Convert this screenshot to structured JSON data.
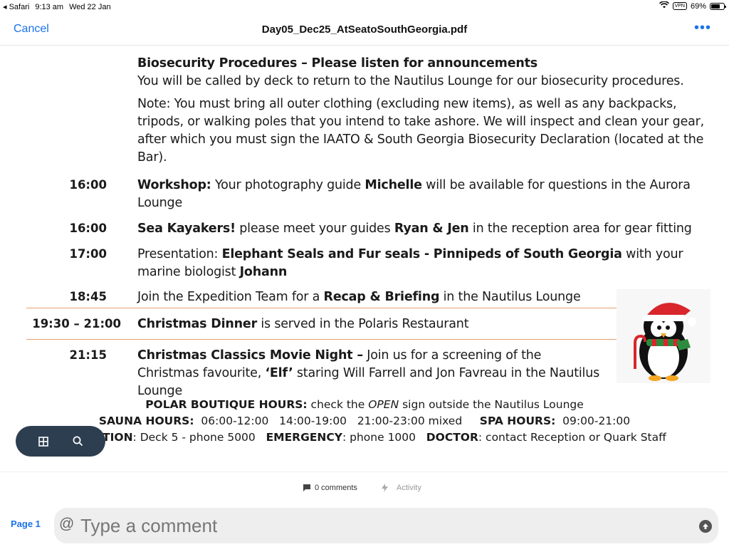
{
  "status_bar": {
    "back_app": "◂ Safari",
    "time": "9:13 am",
    "date": "Wed 22 Jan",
    "vpn": "VPN",
    "battery": "69%",
    "battery_level": 0.69
  },
  "nav": {
    "cancel": "Cancel",
    "title": "Day05_Dec25_AtSeatoSouthGeorgia.pdf",
    "more": "•••"
  },
  "doc": {
    "bio_title": "Biosecurity Procedures – Please listen for announcements",
    "bio_line": "You will be called by deck to return to the Nautilus Lounge for our biosecurity procedures.",
    "bio_note": "Note: You must bring all outer clothing (excluding new items), as well as any backpacks, tripods, or walking poles that you intend to take ashore. We will inspect and clean your gear, after which you must sign the IAATO & South Georgia Biosecurity Declaration (located at the Bar).",
    "events": [
      {
        "time": "16:00",
        "parts": [
          {
            "bold": "Workshop:"
          },
          {
            "text": "  Your photography guide "
          },
          {
            "bold": "Michelle"
          },
          {
            "text": " will be available for questions in the Aurora Lounge"
          }
        ]
      },
      {
        "time": "16:00",
        "parts": [
          {
            "bold": "Sea Kayakers!"
          },
          {
            "text": " please meet your guides "
          },
          {
            "bold": "Ryan & Jen"
          },
          {
            "text": " in the reception area for gear fitting"
          }
        ]
      },
      {
        "time": "17:00",
        "parts": [
          {
            "text": "Presentation:  "
          },
          {
            "bold": "Elephant Seals and Fur seals - Pinnipeds of South Georgia"
          },
          {
            "text": " with your marine biologist "
          },
          {
            "bold": "Johann"
          }
        ]
      },
      {
        "time": "18:45",
        "parts": [
          {
            "text": "Join the Expedition Team for a "
          },
          {
            "bold": "Recap & Briefing"
          },
          {
            "text": " in the Nautilus Lounge"
          }
        ]
      },
      {
        "time": "19:30 – 21:00",
        "parts": [
          {
            "bold": "Christmas Dinner"
          },
          {
            "text": " is served in the Polaris Restaurant"
          }
        ]
      },
      {
        "time": "21:15",
        "parts": [
          {
            "bold": "Christmas Classics Movie Night –"
          },
          {
            "text": " Join us for a screening of the Christmas favourite, "
          },
          {
            "bold": "‘Elf’"
          },
          {
            "text": " staring Will Farrell and Jon Favreau in the Nautilus Lounge"
          }
        ]
      }
    ],
    "footer_lines": [
      [
        {
          "bold": "POLAR BOUTIQUE HOURS:"
        },
        {
          "text": " check the "
        },
        {
          "italic": "OPEN"
        },
        {
          "text": " sign outside the Nautilus Lounge"
        }
      ],
      [
        {
          "bold": "SAUNA HOURS:"
        },
        {
          "text": "  06:00-12:00   14:00-19:00   21:00-23:00 mixed     "
        },
        {
          "bold": "SPA HOURS:"
        },
        {
          "text": "  09:00-21:00"
        }
      ],
      [
        {
          "bold": "RECEPTION"
        },
        {
          "text": ": Deck 5 - phone 5000   "
        },
        {
          "bold": "EMERGENCY"
        },
        {
          "text": ": phone 1000   "
        },
        {
          "bold": "DOCTOR"
        },
        {
          "text": ": contact Reception or Quark Staff"
        }
      ]
    ]
  },
  "activity": {
    "comments": "0 comments",
    "activity": "Activity"
  },
  "comment_bar": {
    "page": "Page 1",
    "at": "@",
    "placeholder": "Type a comment"
  },
  "colors": {
    "accent": "#1a73e8",
    "divider": "#e8a070",
    "pill": "#2d3e50"
  }
}
